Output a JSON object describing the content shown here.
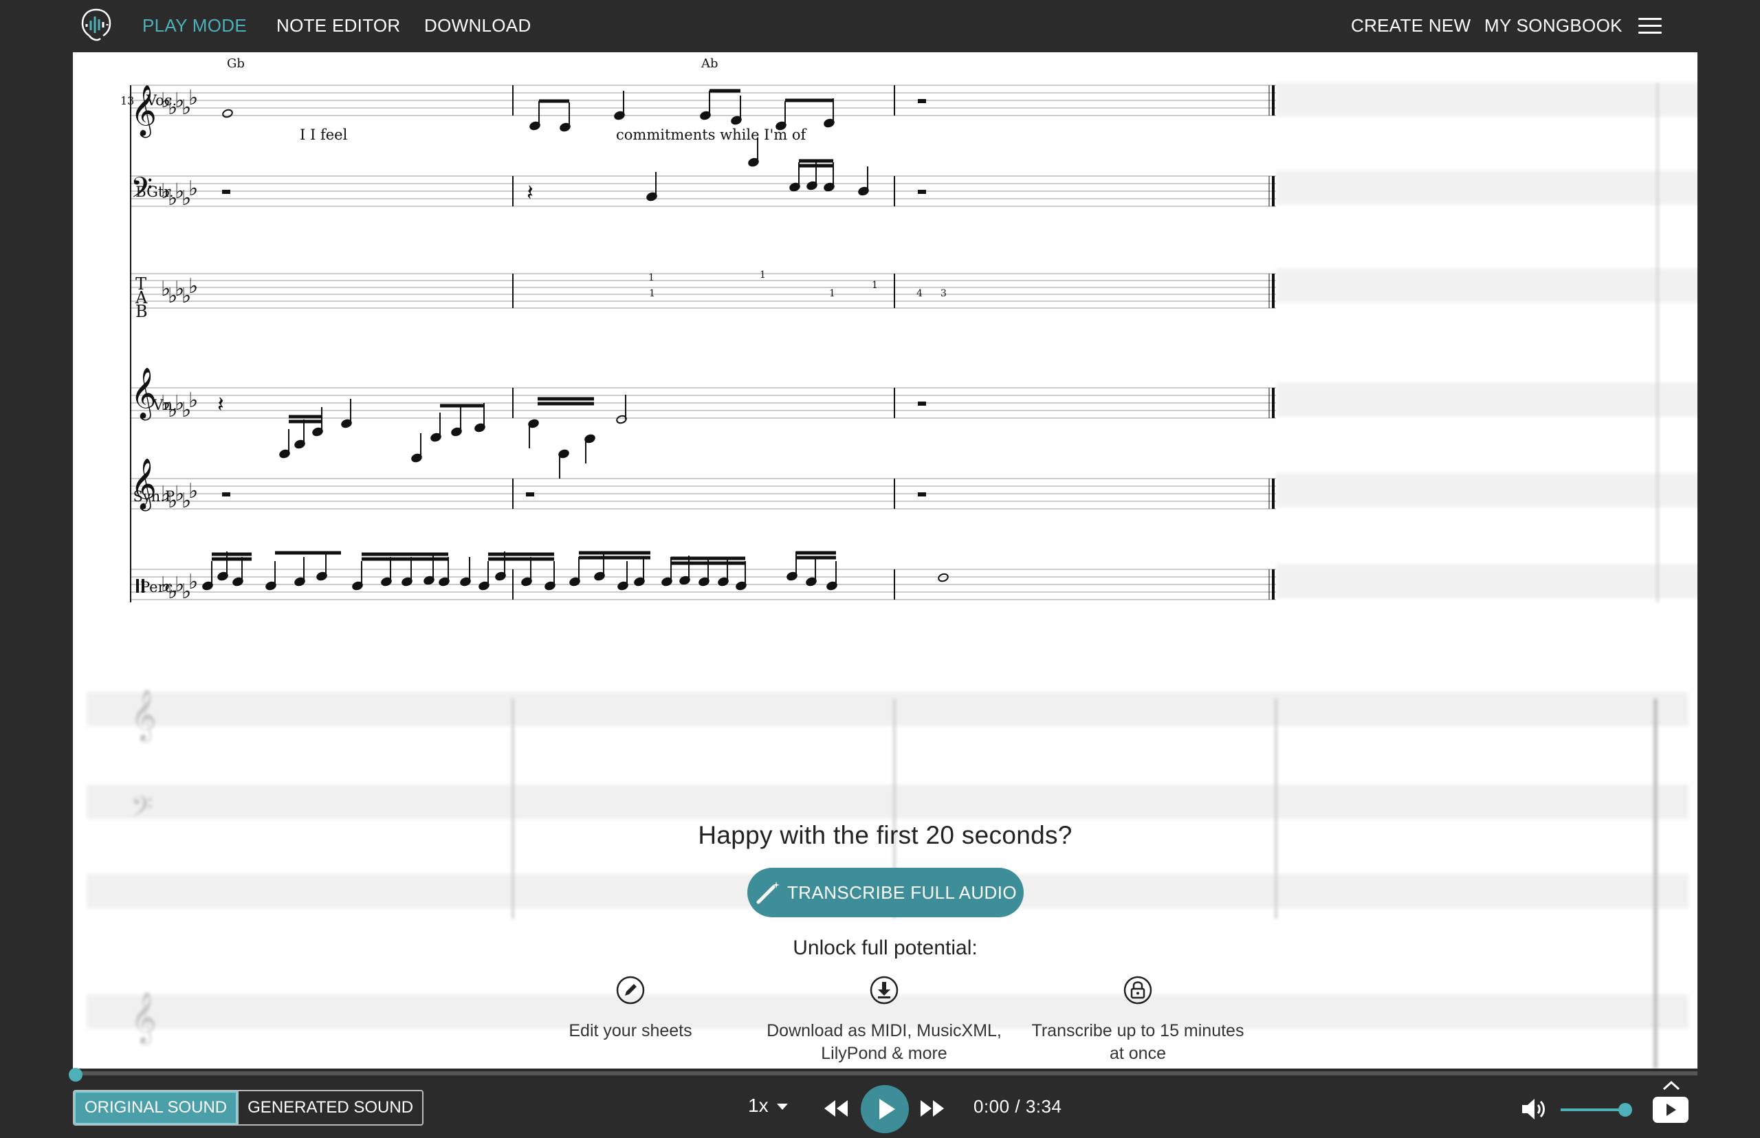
{
  "topbar": {
    "nav_left": [
      "PLAY MODE",
      "NOTE EDITOR",
      "DOWNLOAD"
    ],
    "nav_right": [
      "CREATE NEW",
      "MY SONGBOOK"
    ],
    "active_item": "PLAY MODE",
    "accent_color": "#4eb1b9"
  },
  "score": {
    "measure_number": "13",
    "chords": [
      "Gb",
      "Ab"
    ],
    "staves": [
      "Voc.",
      "BGtr.",
      "Vn.",
      "Syn.P.",
      "Perc."
    ],
    "lyrics": [
      "I I feel",
      "commitments while I'm of"
    ],
    "tab_letters": [
      "T",
      "A",
      "B"
    ],
    "tab_numbers": [
      "1",
      "1",
      "1",
      "1",
      "4",
      "3",
      "1"
    ]
  },
  "promo": {
    "title": "Happy with the first 20 seconds?",
    "cta_label": "TRANSCRIBE FULL AUDIO",
    "unlock_label": "Unlock full potential:",
    "features": [
      {
        "icon": "pencil-icon",
        "line1": "Edit your sheets",
        "line2": ""
      },
      {
        "icon": "download-icon",
        "line1": "Download as MIDI, MusicXML,",
        "line2": "LilyPond & more"
      },
      {
        "icon": "lock-icon",
        "line1": "Transcribe up to 15 minutes",
        "line2": "at once"
      }
    ]
  },
  "player": {
    "original_sound": "ORIGINAL SOUND",
    "generated_sound": "GENERATED SOUND",
    "speed": "1x",
    "current_time": "0:00",
    "separator": "/",
    "total_time": "3:34",
    "progress": 0.0,
    "volume": 0.9
  }
}
